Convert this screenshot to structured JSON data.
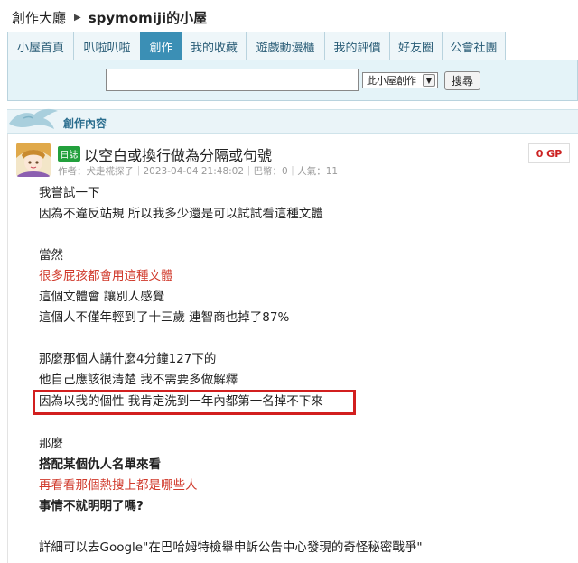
{
  "breadcrumb": {
    "root": "創作大廳",
    "user": "spymomiji的小屋"
  },
  "tabs": [
    {
      "label": "小屋首頁",
      "active": false
    },
    {
      "label": "叭啦叭啦",
      "active": false
    },
    {
      "label": "創作",
      "active": true
    },
    {
      "label": "我的收藏",
      "active": false
    },
    {
      "label": "遊戲動漫櫃",
      "active": false
    },
    {
      "label": "我的評價",
      "active": false
    },
    {
      "label": "好友圈",
      "active": false
    },
    {
      "label": "公會社團",
      "active": false
    }
  ],
  "search": {
    "input_value": "",
    "scope_selected": "此小屋創作",
    "button_label": "搜尋"
  },
  "section": {
    "title": "創作內容"
  },
  "post": {
    "badge": "日誌",
    "title": "以空白或換行做為分隔或句號",
    "meta": {
      "author_label": "作者：",
      "author": "犬走椛探子",
      "sep1": "｜",
      "datetime": "2023-04-04 21:48:02",
      "sep2": "｜",
      "bahamut": "巴幣：0",
      "sep3": "｜",
      "views": "人氣：11"
    },
    "gp": "0 GP",
    "lines": [
      {
        "text": "我嘗試一下",
        "style": "normal"
      },
      {
        "text": "因為不違反站規 所以我多少還是可以試試看這種文體",
        "style": "normal"
      },
      {
        "text": "當然",
        "style": "normal"
      },
      {
        "text": "很多屁孩都會用這種文體",
        "style": "red"
      },
      {
        "text": "這個文體會 讓別人感覺",
        "style": "normal"
      },
      {
        "text": "這個人不僅年輕到了十三歲 連智商也掉了87%",
        "style": "normal"
      },
      {
        "text": "那麼那個人講什麼4分鐘127下的",
        "style": "normal"
      },
      {
        "text": "他自己應該很清楚 我不需要多做解釋",
        "style": "normal"
      },
      {
        "text": "因為以我的個性 我肯定洗到一年內都第一名掉不下來",
        "style": "normal"
      },
      {
        "text": "那麼",
        "style": "normal"
      },
      {
        "text": "搭配某個仇人名單來看",
        "style": "bold"
      },
      {
        "text": "再看看那個熱搜上都是哪些人",
        "style": "red"
      },
      {
        "text": "事情不就明明了嗎?",
        "style": "bold"
      },
      {
        "text": "詳細可以去Google\"在巴哈姆特檢舉申訴公告中心發現的奇怪秘密戰爭\"",
        "style": "normal"
      }
    ]
  },
  "colors": {
    "accent": "#3b8fb5",
    "red": "#d0392b",
    "badge_green": "#22a03c",
    "highlight": "#d21f1f"
  }
}
